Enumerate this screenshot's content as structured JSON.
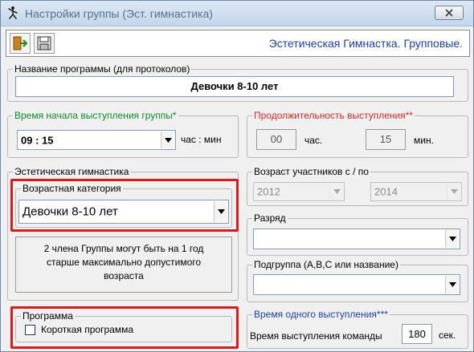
{
  "window": {
    "title": "Настройки группы (Эст. гимнастика)",
    "app_icon": "gymnast-icon",
    "close_icon": "close-icon"
  },
  "toolbar": {
    "exit_icon": "exit-door-icon",
    "save_icon": "floppy-disk-icon",
    "caption": "Эстетическая Гимнастка. Групповые."
  },
  "program_name": {
    "legend": "Название программы (для протоколов)",
    "value": "Девочки 8-10 лет"
  },
  "start_time": {
    "legend": "Время начала выступления группы",
    "required_mark": "*",
    "value": "09 : 15",
    "unit": "час : мин"
  },
  "duration": {
    "legend": "Продолжительность выступления",
    "required_mark": "**",
    "hours_value": "00",
    "hours_label": "час.",
    "minutes_value": "15",
    "minutes_label": "мин."
  },
  "aesthetic": {
    "legend": "Эстетическая гимнастика",
    "age_category_legend": "Возрастная категория",
    "age_category_value": "Девочки 8-10 лет",
    "note_lines": [
      "2 члена Группы могут быть на 1 год",
      "старше максимально допустимого",
      "возраста"
    ]
  },
  "age_range": {
    "legend": "Возраст участников с / по",
    "from_value": "2012",
    "to_value": "2014"
  },
  "rank": {
    "legend": "Разряд",
    "value": ""
  },
  "subgroup": {
    "legend": "Подгруппа (A,B,C или название)",
    "value": ""
  },
  "program": {
    "legend": "Программа",
    "short_program_label": "Короткая программа",
    "short_program_checked": false
  },
  "single_time": {
    "legend": "Время одного выступления",
    "required_mark": "***",
    "label": "Время выступления команды",
    "value": "180",
    "unit": "сек."
  },
  "colors": {
    "required_green": "#0f8a2a",
    "required_red": "#cf2a2a",
    "caption_blue": "#1f3fa8",
    "highlight_red": "#d81b1b"
  }
}
